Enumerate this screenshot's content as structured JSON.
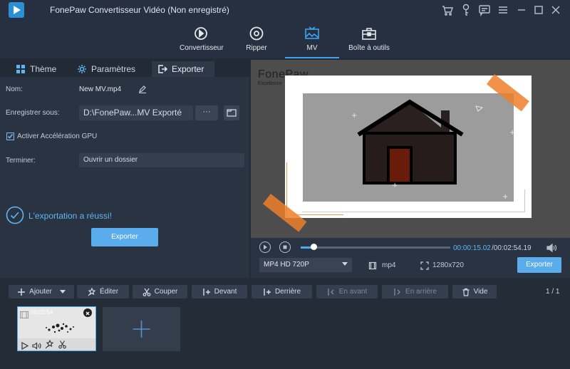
{
  "app": {
    "title": "FonePaw Convertisseur Vidéo (Non enregistré)"
  },
  "titlebar_icons": [
    "cart-icon",
    "key-icon",
    "chat-icon",
    "menu-icon",
    "minimize-icon",
    "maximize-icon",
    "close-icon"
  ],
  "nav": [
    {
      "label": "Convertisseur",
      "icon": "convert-icon"
    },
    {
      "label": "Ripper",
      "icon": "disc-icon"
    },
    {
      "label": "MV",
      "icon": "mv-icon",
      "active": true
    },
    {
      "label": "Boîte à outils",
      "icon": "toolbox-icon"
    }
  ],
  "tabs": [
    {
      "label": "Thème",
      "icon": "theme-icon"
    },
    {
      "label": "Paramètres",
      "icon": "gear-icon"
    },
    {
      "label": "Exporter",
      "icon": "export-icon",
      "active": true
    }
  ],
  "export": {
    "name_label": "Nom:",
    "name_value": "New MV.mp4",
    "save_label": "Enregistrer sous:",
    "save_path": "D:\\FonePaw...MV Exporté",
    "browse_label": "···",
    "gpu_label": "Activer Accélération GPU",
    "gpu_checked": true,
    "finish_label": "Terminer:",
    "finish_value": "Ouvrir un dossier",
    "success_text": "L'exportation a réussi!",
    "export_button": "Exporter"
  },
  "preview": {
    "watermark": "FonePaw",
    "watermark_sub": "Excellence"
  },
  "player": {
    "current_time": "00:00:15.02",
    "total_time": "/00:02:54.19",
    "progress": 0.086,
    "format": "MP4 HD 720P",
    "container": "mp4",
    "resolution": "1280x720",
    "export_button": "Exporter"
  },
  "toolbar": [
    {
      "label": "Ajouter",
      "icon": "plus-icon",
      "dim": false
    },
    {
      "label": "Éditer",
      "icon": "magic-icon",
      "dim": false
    },
    {
      "label": "Couper",
      "icon": "scissors-icon",
      "dim": false
    },
    {
      "label": "Devant",
      "icon": "front-icon",
      "dim": false
    },
    {
      "label": "Derrière",
      "icon": "back-icon",
      "dim": false
    },
    {
      "label": "En avant",
      "icon": "forward-icon",
      "dim": true
    },
    {
      "label": "En arrière",
      "icon": "backward-icon",
      "dim": true
    },
    {
      "label": "Vide",
      "icon": "trash-icon",
      "dim": false
    }
  ],
  "page_count": "1 / 1",
  "clip": {
    "duration": "00:02:54"
  },
  "colors": {
    "accent": "#3ea4f0",
    "button": "#5aacec",
    "tape": "#ee7f2a"
  }
}
